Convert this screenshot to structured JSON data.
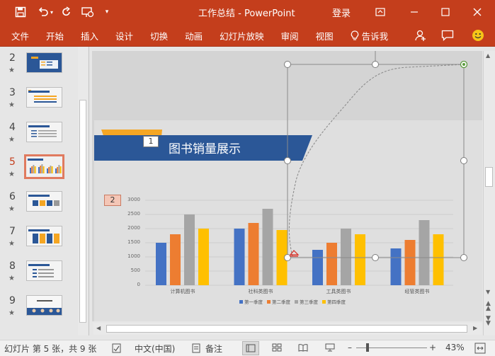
{
  "app": {
    "title": "工作总结  -  PowerPoint",
    "login": "登录"
  },
  "ribbon": {
    "tabs": [
      "文件",
      "开始",
      "插入",
      "设计",
      "切换",
      "动画",
      "幻灯片放映",
      "审阅",
      "视图"
    ],
    "tell_me": "告诉我"
  },
  "thumbnails": [
    {
      "num": "2"
    },
    {
      "num": "3"
    },
    {
      "num": "4"
    },
    {
      "num": "5"
    },
    {
      "num": "6"
    },
    {
      "num": "7"
    },
    {
      "num": "8"
    },
    {
      "num": "9"
    }
  ],
  "slide": {
    "title": "图书销量展示",
    "anim_tag_1": "1",
    "anim_tag_2": "2"
  },
  "chart_data": {
    "type": "bar",
    "categories": [
      "计算机图书",
      "社科类图书",
      "工具类图书",
      "经管类图书"
    ],
    "series": [
      {
        "name": "第一季度",
        "color": "#4472c4",
        "values": [
          1500,
          2000,
          1250,
          1300
        ]
      },
      {
        "name": "第二季度",
        "color": "#ed7d31",
        "values": [
          1800,
          2200,
          1500,
          1600
        ]
      },
      {
        "name": "第三季度",
        "color": "#a5a5a5",
        "values": [
          2500,
          2700,
          2000,
          2300
        ]
      },
      {
        "name": "第四季度",
        "color": "#ffc000",
        "values": [
          2000,
          1950,
          1800,
          1800
        ]
      }
    ],
    "ylim": [
      0,
      3000
    ],
    "yticks": [
      "0",
      "500",
      "1000",
      "1500",
      "2000",
      "2500",
      "3000"
    ],
    "legend": "bottom"
  },
  "status": {
    "slide_info": "幻灯片 第 5 张，共 9 张",
    "language": "中文(中国)",
    "notes": "备注",
    "zoom": "43%"
  },
  "colors": {
    "accent": "#c43e1c",
    "slide_banner": "#2b5797",
    "banner_tab": "#f5a623"
  }
}
